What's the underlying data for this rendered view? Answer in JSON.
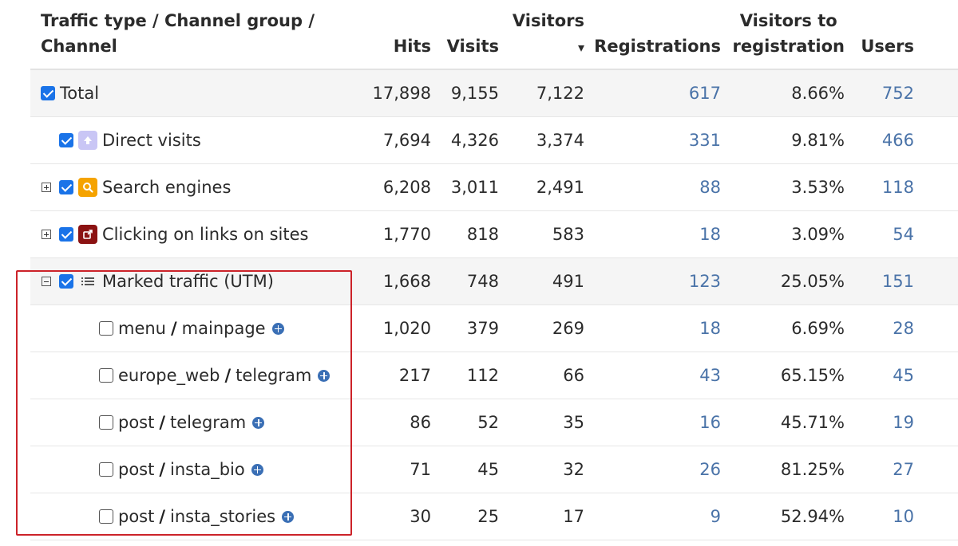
{
  "headers": {
    "channel_line1": "Traffic type / Channel group /",
    "channel_line2": "Channel",
    "hits": "Hits",
    "visits": "Visits",
    "visitors": "Visitors",
    "registrations": "Registrations",
    "v2r_line1": "Visitors to",
    "v2r_line2": "registration",
    "users": "Users",
    "sort_indicator": "▾"
  },
  "rows": [
    {
      "label": "Total",
      "hits": "17,898",
      "visits": "9,155",
      "visitors": "7,122",
      "registrations": "617",
      "v2r": "8.66%",
      "users": "752"
    },
    {
      "label": "Direct visits",
      "hits": "7,694",
      "visits": "4,326",
      "visitors": "3,374",
      "registrations": "331",
      "v2r": "9.81%",
      "users": "466"
    },
    {
      "label": "Search engines",
      "hits": "6,208",
      "visits": "3,011",
      "visitors": "2,491",
      "registrations": "88",
      "v2r": "3.53%",
      "users": "118"
    },
    {
      "label": "Clicking on links on sites",
      "hits": "1,770",
      "visits": "818",
      "visitors": "583",
      "registrations": "18",
      "v2r": "3.09%",
      "users": "54"
    },
    {
      "label": "Marked traffic (UTM)",
      "hits": "1,668",
      "visits": "748",
      "visitors": "491",
      "registrations": "123",
      "v2r": "25.05%",
      "users": "151"
    },
    {
      "source": "menu",
      "medium": "mainpage",
      "hits": "1,020",
      "visits": "379",
      "visitors": "269",
      "registrations": "18",
      "v2r": "6.69%",
      "users": "28"
    },
    {
      "source": "europe_web",
      "medium": "telegram",
      "hits": "217",
      "visits": "112",
      "visitors": "66",
      "registrations": "43",
      "v2r": "65.15%",
      "users": "45"
    },
    {
      "source": "post",
      "medium": "telegram",
      "hits": "86",
      "visits": "52",
      "visitors": "35",
      "registrations": "16",
      "v2r": "45.71%",
      "users": "19"
    },
    {
      "source": "post",
      "medium": "insta_bio",
      "hits": "71",
      "visits": "45",
      "visitors": "32",
      "registrations": "26",
      "v2r": "81.25%",
      "users": "27"
    },
    {
      "source": "post",
      "medium": "insta_stories",
      "hits": "30",
      "visits": "25",
      "visitors": "17",
      "registrations": "9",
      "v2r": "52.94%",
      "users": "10"
    }
  ],
  "separator": "/",
  "colors": {
    "checkbox": "#1a73e8",
    "link": "#4a73a8",
    "direct_icon": "#c9c6f5",
    "search_icon": "#f5a300",
    "links_icon": "#8b1212",
    "highlight": "#cc2229"
  },
  "icons": {
    "direct": "arrow-up-icon",
    "search": "magnifier-icon",
    "links": "external-link-icon",
    "utm": "list-icon"
  }
}
